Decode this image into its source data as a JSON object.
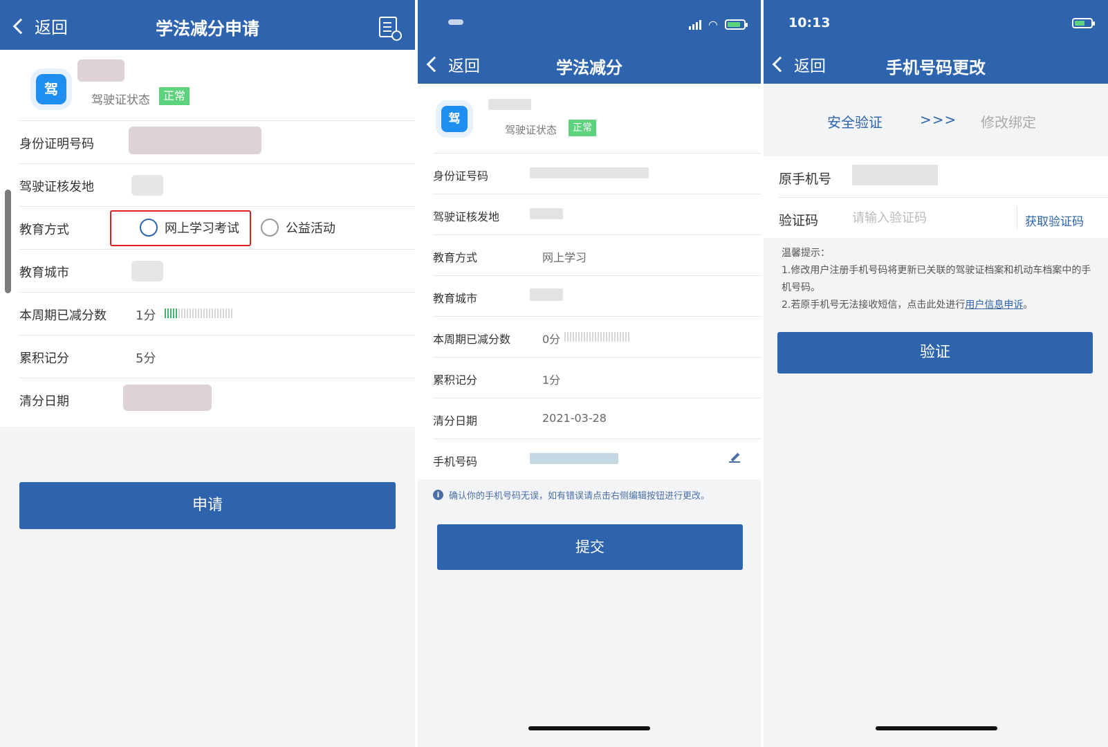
{
  "screen1": {
    "header": {
      "back_label": "返回",
      "title": "学法减分申请",
      "right_icon": "document-history-icon"
    },
    "profile": {
      "license_icon_text": "驾",
      "status_label": "驾驶证状态",
      "status_badge": "正常",
      "badge_color": "#5cd37c"
    },
    "rows": {
      "id_number": {
        "label": "身份证明号码"
      },
      "issue_place": {
        "label": "驾驶证核发地"
      },
      "edu_method": {
        "label": "教育方式",
        "option_online": "网上学习考试",
        "option_public": "公益活动"
      },
      "edu_city": {
        "label": "教育城市"
      },
      "reduced": {
        "label": "本周期已减分数",
        "value": "1分",
        "progress": 0.18
      },
      "accumulated": {
        "label": "累积记分",
        "value": "5分"
      },
      "clear_date": {
        "label": "清分日期"
      }
    },
    "submit_label": "申请"
  },
  "screen2": {
    "header": {
      "back_label": "返回",
      "title": "学法减分"
    },
    "profile": {
      "license_icon_text": "驾",
      "status_label": "驾驶证状态",
      "status_badge": "正常"
    },
    "rows": {
      "id_number": {
        "label": "身份证号码"
      },
      "issue_place": {
        "label": "驾驶证核发地"
      },
      "edu_method": {
        "label": "教育方式",
        "value": "网上学习"
      },
      "edu_city": {
        "label": "教育城市"
      },
      "reduced": {
        "label": "本周期已减分数",
        "value": "0分",
        "progress": 0
      },
      "accumulated": {
        "label": "累积记分",
        "value": "1分"
      },
      "clear_date": {
        "label": "清分日期",
        "value": "2021-03-28"
      },
      "phone": {
        "label": "手机号码",
        "edit_icon": "pencil-icon"
      }
    },
    "notice": "确认你的手机号码无误，如有错误请点击右侧编辑按钮进行更改。",
    "submit_label": "提交"
  },
  "screen3": {
    "status_bar": {
      "time": "10:13"
    },
    "header": {
      "back_label": "返回",
      "title": "手机号码更改"
    },
    "steps": {
      "step1": "安全验证",
      "arrows": ">>>",
      "step2": "修改绑定"
    },
    "fields": {
      "old_phone_label": "原手机号",
      "code_label": "验证码",
      "code_placeholder": "请输入验证码",
      "get_code": "获取验证码"
    },
    "tips": {
      "title": "温馨提示：",
      "line1": "1.修改用户注册手机号码将更新已关联的驾驶证档案和机动车档案中的手机号码。",
      "line2_prefix": "2.若原手机号无法接收短信，点击此处进行",
      "line2_link": "用户信息申诉",
      "line2_suffix": "。"
    },
    "submit_label": "验证"
  },
  "colors": {
    "header_blue": "#2e63ae",
    "highlight_red": "#e02020",
    "progress_green": "#3bb66a"
  }
}
